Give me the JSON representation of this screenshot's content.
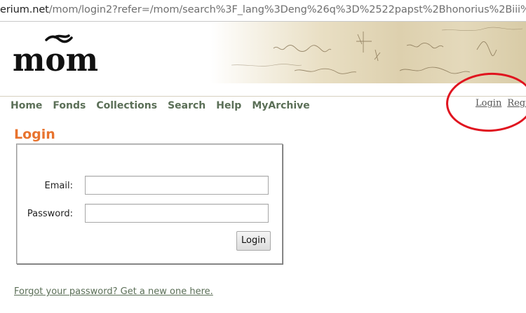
{
  "browser": {
    "url_host": "erium.net",
    "url_path": "/mom/login2?refer=/mom/search%3F_lang%3Deng%26q%3D%2522papst%2Bhonorius%2Biii%25"
  },
  "header": {
    "logo_text": "mom"
  },
  "nav": {
    "items": [
      "Home",
      "Fonds",
      "Collections",
      "Search",
      "Help",
      "MyArchive"
    ]
  },
  "auth": {
    "login_label": "Login",
    "register_label": "Regi"
  },
  "login": {
    "title": "Login",
    "email_label": "Email:",
    "password_label": "Password:",
    "email_value": "",
    "password_value": "",
    "submit_label": "Login",
    "forgot_link": "Forgot your password? Get a new one here."
  },
  "colors": {
    "nav_text": "#5b6f57",
    "title": "#e8732e",
    "highlight_circle": "#e0141f"
  }
}
